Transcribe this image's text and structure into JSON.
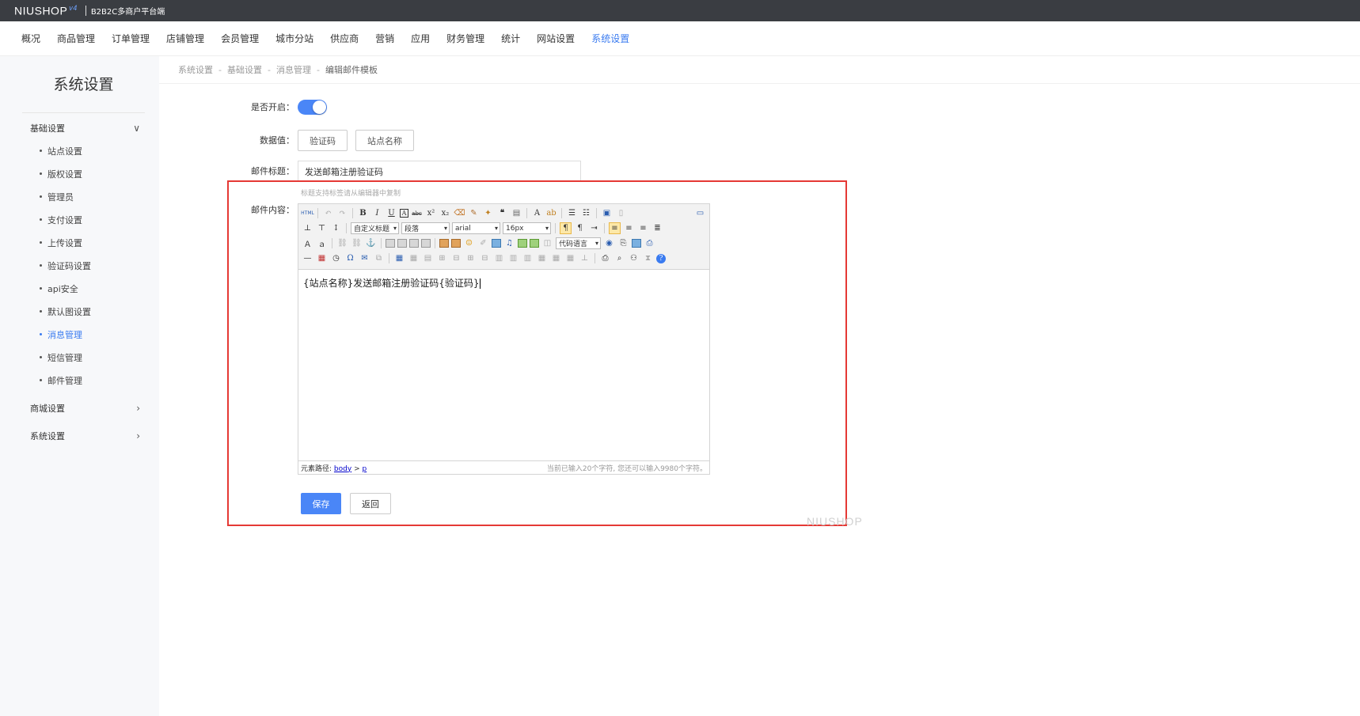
{
  "topbar": {
    "logo": "NIUSHOP",
    "logo_badge": "v4",
    "subtitle": "B2B2C多商户平台端"
  },
  "nav": [
    "概况",
    "商品管理",
    "订单管理",
    "店铺管理",
    "会员管理",
    "城市分站",
    "供应商",
    "营销",
    "应用",
    "财务管理",
    "统计",
    "网站设置",
    "系统设置"
  ],
  "nav_active_index": 12,
  "sidebar": {
    "title": "系统设置",
    "groups": [
      {
        "label": "基础设置",
        "expanded": true,
        "items": [
          "站点设置",
          "版权设置",
          "管理员",
          "支付设置",
          "上传设置",
          "验证码设置",
          "api安全",
          "默认图设置",
          "消息管理",
          "短信管理",
          "邮件管理"
        ]
      },
      {
        "label": "商城设置",
        "expanded": false
      },
      {
        "label": "系统设置",
        "expanded": false
      }
    ],
    "active_item": "消息管理"
  },
  "breadcrumb": [
    "系统设置",
    "基础设置",
    "消息管理",
    "编辑邮件模板"
  ],
  "form": {
    "enable_label": "是否开启：",
    "enabled": true,
    "data_label": "数据值：",
    "data_values": [
      "验证码",
      "站点名称"
    ],
    "subject_label": "邮件标题：",
    "subject_value": "发送邮箱注册验证码",
    "subject_hint": "标题支持标签请从编辑器中复制",
    "content_label": "邮件内容：",
    "content_value": "{站点名称}发送邮箱注册验证码{验证码}",
    "editor_path_label": "元素路径:",
    "editor_path_body": "body",
    "editor_path_sep": ">",
    "editor_path_p": "p",
    "editor_count": "当前已输入20个字符, 您还可以输入9980个字符。",
    "toolbar_selects": {
      "heading": "自定义标题",
      "paragraph": "段落",
      "font": "arial",
      "size": "16px",
      "code": "代码语言"
    },
    "toolbar_html_label": "HTML",
    "save_label": "保存",
    "back_label": "返回"
  },
  "watermark": "NIUSHOP",
  "colors": {
    "accent": "#4a86f7",
    "highlight_border": "#e53935",
    "topbar": "#3a3d42"
  }
}
